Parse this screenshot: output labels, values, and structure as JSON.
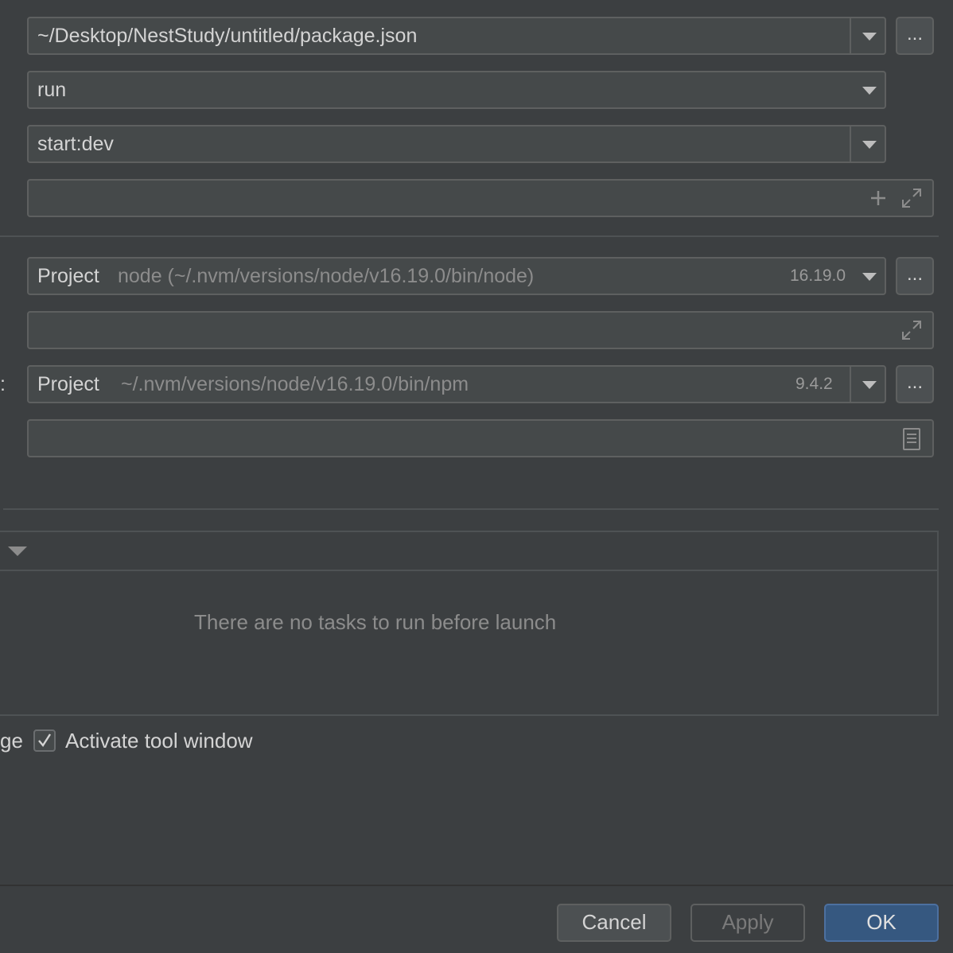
{
  "package_json": {
    "value": "~/Desktop/NestStudy/untitled/package.json",
    "browse_label": "..."
  },
  "command": {
    "value": "run"
  },
  "scripts": {
    "value": "start:dev"
  },
  "arguments": {
    "value": ""
  },
  "node_interpreter": {
    "scope": "Project",
    "path": "node (~/.nvm/versions/node/v16.19.0/bin/node)",
    "version": "16.19.0",
    "browse_label": "..."
  },
  "node_options": {
    "value": ""
  },
  "package_manager": {
    "label_fragment": ":",
    "scope": "Project",
    "path": "~/.nvm/versions/node/v16.19.0/bin/npm",
    "version": "9.4.2",
    "browse_label": "..."
  },
  "environment": {
    "value": ""
  },
  "before_launch": {
    "empty_text": "There are no tasks to run before launch"
  },
  "options": {
    "left_fragment": "ge",
    "activate_tool_window": {
      "label": "Activate tool window",
      "checked": true
    }
  },
  "footer": {
    "cancel": "Cancel",
    "apply": "Apply",
    "ok": "OK"
  },
  "colors": {
    "background": "#3c3f41",
    "field": "#45494a",
    "border": "#5e6060",
    "ok_button": "#365880"
  }
}
